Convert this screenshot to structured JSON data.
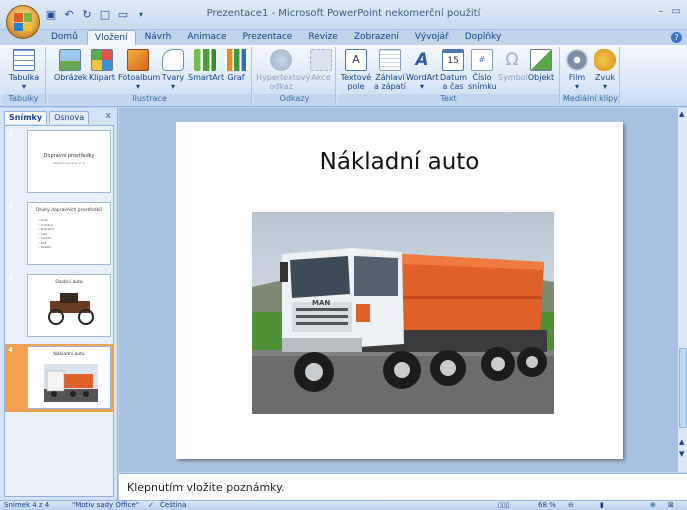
{
  "window": {
    "title": "Prezentace1 - Microsoft PowerPoint nekomerční použití"
  },
  "tabs": [
    {
      "label": "Domů"
    },
    {
      "label": "Vložení"
    },
    {
      "label": "Návrh"
    },
    {
      "label": "Animace"
    },
    {
      "label": "Prezentace"
    },
    {
      "label": "Revize"
    },
    {
      "label": "Zobrazení"
    },
    {
      "label": "Vývojář"
    },
    {
      "label": "Doplňky"
    }
  ],
  "ribbon": {
    "groups": {
      "tabulky": "Tabulky",
      "ilustrace": "Ilustrace",
      "odkazy": "Odkazy",
      "text": "Text",
      "media": "Mediální klipy"
    },
    "buttons": {
      "tabulka": "Tabulka",
      "obrazek": "Obrázek",
      "klipart": "Klipart",
      "fotoalbum": "Fotoalbum",
      "tvary": "Tvary",
      "smartart": "SmartArt",
      "graf": "Graf",
      "hypertext1": "Hypertextový",
      "hypertext2": "odkaz",
      "akce": "Akce",
      "textove1": "Textové",
      "textove2": "pole",
      "zahlavi1": "Záhlaví",
      "zahlavi2": "a zápatí",
      "wordart": "WordArt",
      "datum1": "Datum",
      "datum2": "a čas",
      "cislo1": "Číslo",
      "cislo2": "snímku",
      "symbol": "Symbol",
      "objekt": "Objekt",
      "film": "Film",
      "zvuk": "Zvuk"
    }
  },
  "leftpane": {
    "tab_slides": "Snímky",
    "tab_outline": "Osnova",
    "close": "x",
    "thumbs": [
      {
        "num": "1",
        "title": "Dopravní prostředky",
        "subtitle": "Osobní doprava, tř. A"
      },
      {
        "num": "2",
        "title": "Druhy dopravních prostředků",
        "items": [
          "Auto",
          "Autobus",
          "Nákladní",
          "Vlak",
          "Letadlo",
          "Loď",
          "Raketa"
        ]
      },
      {
        "num": "3",
        "title": "Osobní auto"
      },
      {
        "num": "4",
        "title": "Nákladní auto"
      }
    ]
  },
  "slide": {
    "title": "Nákladní auto"
  },
  "notes": {
    "placeholder": "Klepnutím vložíte poznámky."
  },
  "statusbar": {
    "slide": "Snímek 4 z 4",
    "theme": "\"Motiv sady Office\"",
    "language": "Čeština",
    "zoom": "68 %"
  },
  "colors": {
    "ribbon_accent": "#15428b",
    "truck_orange": "#e0602a",
    "selected_thumb": "#f0a050"
  }
}
